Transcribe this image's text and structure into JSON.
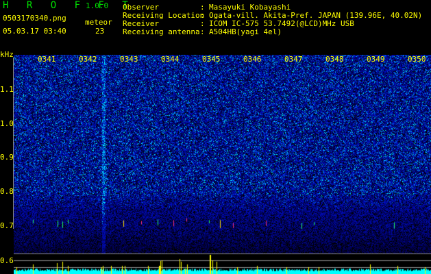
{
  "header": {
    "app_name": "H R O F F T",
    "version": "1.0.0",
    "filename": "0503170340.png",
    "datetime": "05.03.17 03:40",
    "meteor_label": "meteor",
    "meteor_count": "23"
  },
  "station_info": [
    {
      "label": "Observer",
      "value": "Masayuki Kobayashi"
    },
    {
      "label": "Receiving Location",
      "value": "Ogata-vill. Akita-Pref. JAPAN (139.96E, 40.02N)"
    },
    {
      "label": "Receiver",
      "value": "ICOM IC-575 53.7492(@LCD)MHz USB"
    },
    {
      "label": "Receiving antenna",
      "value": "A504HB(yagi 4el)"
    }
  ],
  "spectrogram": {
    "y_unit": "kHz",
    "y_ticks": [
      "1.1",
      "1.0",
      "0.9",
      "0.8",
      "0.7",
      "0.6"
    ],
    "time_ticks": [
      "0341",
      "0342",
      "0343",
      "0344",
      "0345",
      "0346",
      "0347",
      "0348",
      "0349",
      "0350"
    ],
    "colors": {
      "text": "#ffff00",
      "title": "#00e000",
      "noise": "#1020c0",
      "count_bar": "#00ffff",
      "echo_bar": "#ffff00"
    }
  }
}
